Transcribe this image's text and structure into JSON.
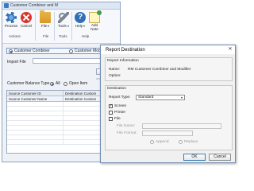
{
  "main_window": {
    "title": "Customer Combiner and M",
    "ribbon": {
      "process_label": "Process",
      "cancel_label": "Cancel",
      "file_label": "File",
      "tools_label": "Tools",
      "help_label": "Help",
      "add_note_label": "Add\nNote",
      "groups": [
        "Actions",
        "File",
        "Tools",
        "Help"
      ]
    },
    "mode_options": {
      "combiner_label": "Customer Combiner",
      "modifier_label": "Customer Modifier",
      "selected": "Customer Combiner"
    },
    "import_file_label": "Import File",
    "remove_button": "Remove",
    "balance_type": {
      "label": "Customer Balance Type",
      "options": [
        "All",
        "Open Item"
      ],
      "selected": "All"
    },
    "grid": {
      "col1_header": "Source Customer ID",
      "col2_header": "Destination Custom",
      "col1_sub": "Source Customer Name",
      "col2_sub": "Destination Custom"
    }
  },
  "dialog": {
    "title": "Report Destination",
    "close_glyph": "✕",
    "report_info": {
      "header": "Report Information",
      "name_label": "Name:",
      "name_value": "RM Customer Combiner and Modifier",
      "option_label": "Option:",
      "option_value": ""
    },
    "destination": {
      "header": "Destination",
      "report_type_label": "Report Type:",
      "report_type_value": "Standard",
      "screen_label": "Screen",
      "screen_checked": true,
      "printer_label": "Printer",
      "printer_checked": false,
      "file_label": "File",
      "file_checked": false,
      "file_name_label": "File Name:",
      "file_format_label": "File Format:",
      "append_label": "Append",
      "replace_label": "Replace"
    },
    "buttons": {
      "ok": "OK",
      "cancel": "Cancel"
    }
  }
}
